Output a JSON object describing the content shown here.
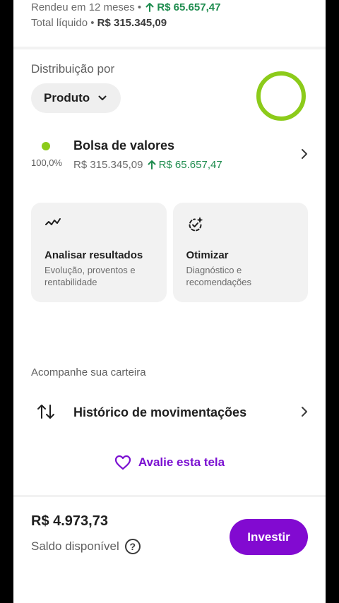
{
  "summary": {
    "yield_label": "Rendeu em 12 meses •",
    "yield_value": "R$ 65.657,47",
    "total_label": "Total líquido •",
    "total_value": "R$ 315.345,09"
  },
  "distribution": {
    "label": "Distribuição por",
    "chip_label": "Produto"
  },
  "assets": [
    {
      "name": "Bolsa de valores",
      "percent": "100,0%",
      "value": "R$ 315.345,09",
      "gain": "R$ 65.657,47",
      "dot_color": "#8ccb1a"
    }
  ],
  "cards": [
    {
      "title": "Analisar resultados",
      "subtitle": "Evolução, proventos e rentabilidade",
      "icon": "trend-icon"
    },
    {
      "title": "Otimizar",
      "subtitle": "Diagnóstico e recomendações",
      "icon": "sparkle-refresh-icon"
    }
  ],
  "track": {
    "label": "Acompanhe sua carteira",
    "history_label": "Histórico de movimentações"
  },
  "rate": {
    "label": "Avalie esta tela"
  },
  "footer": {
    "balance": "R$ 4.973,73",
    "balance_label": "Saldo disponível",
    "help_glyph": "?",
    "invest_label": "Investir"
  },
  "colors": {
    "accent": "#820ad1",
    "gain": "#1e8c4e",
    "chart_ring": "#8ccb1a"
  }
}
